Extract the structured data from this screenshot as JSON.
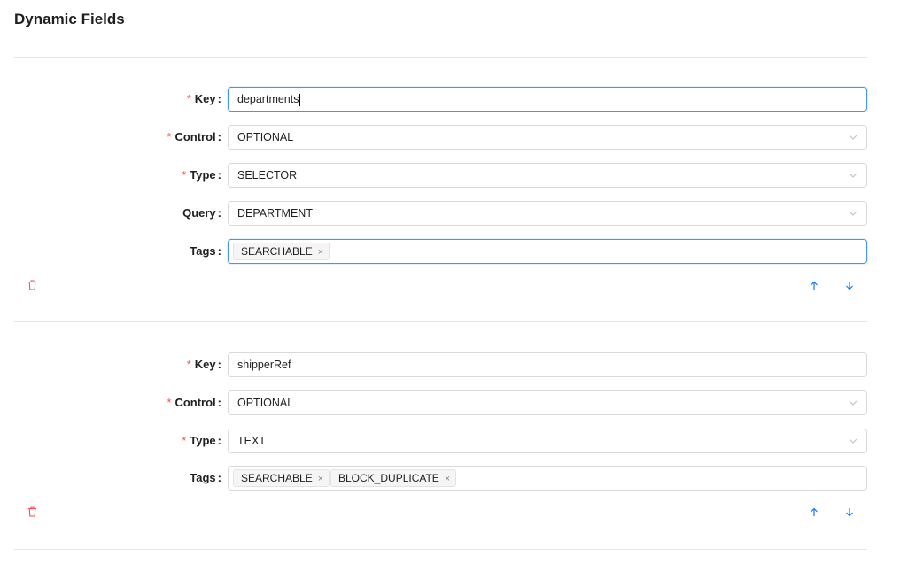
{
  "page": {
    "title": "Dynamic Fields"
  },
  "colors": {
    "accent": "#1677ff",
    "danger": "#ff4d4f",
    "border": "#d9d9d9",
    "focus": "#4096ff"
  },
  "labels": {
    "key": "Key",
    "control": "Control",
    "type": "Type",
    "query": "Query",
    "tags": "Tags"
  },
  "fields": [
    {
      "key": "departments",
      "control": "OPTIONAL",
      "type": "SELECTOR",
      "query": "DEPARTMENT",
      "tags": [
        "SEARCHABLE"
      ]
    },
    {
      "key": "shipperRef",
      "control": "OPTIONAL",
      "type": "TEXT",
      "tags": [
        "SEARCHABLE",
        "BLOCK_DUPLICATE"
      ]
    }
  ],
  "icons": {
    "delete": "delete-icon",
    "move_up": "arrow-up-icon",
    "move_down": "arrow-down-icon",
    "dropdown": "chevron-down-icon",
    "tag_remove": "close-icon"
  },
  "tag_remove_glyph": "×"
}
